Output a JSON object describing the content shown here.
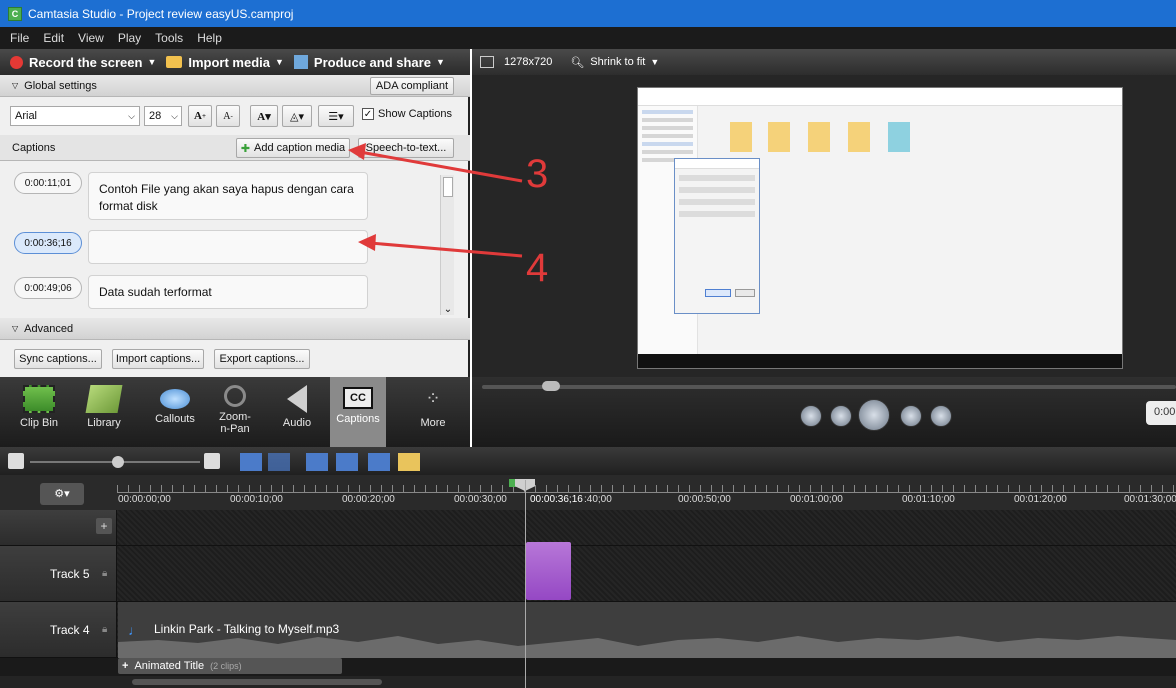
{
  "window": {
    "title": "Camtasia Studio - Project review easyUS.camproj"
  },
  "menu": [
    "File",
    "Edit",
    "View",
    "Play",
    "Tools",
    "Help"
  ],
  "toolbar": {
    "record": "Record the screen",
    "import": "Import media",
    "produce": "Produce and share"
  },
  "global": {
    "header": "Global settings",
    "ada": "ADA compliant",
    "font": "Arial",
    "size": "28",
    "show_captions": "Show Captions"
  },
  "captions": {
    "label": "Captions",
    "add_media": "Add caption media",
    "speech": "Speech-to-text...",
    "items": [
      {
        "time": "0:00:11;01",
        "text": "Contoh File yang akan saya hapus dengan cara format disk"
      },
      {
        "time": "0:00:36;16",
        "text": ""
      },
      {
        "time": "0:00:49;06",
        "text": "Data sudah terformat"
      }
    ]
  },
  "advanced": {
    "header": "Advanced",
    "sync": "Sync captions...",
    "import": "Import captions...",
    "export": "Export captions..."
  },
  "tabs": [
    "Clip Bin",
    "Library",
    "Callouts",
    "Zoom-n-Pan",
    "Audio",
    "Captions",
    "More"
  ],
  "preview": {
    "dimensions": "1278x720",
    "zoom": "Shrink to fit",
    "time": "0:00"
  },
  "annotations": {
    "n3": "3",
    "n4": "4"
  },
  "timeline": {
    "ticks": [
      "00:00:00;00",
      "00:00:10;00",
      "00:00:20;00",
      "00:00:30;00",
      ":40;00",
      "00:00:50;00",
      "00:01:00;00",
      "00:01:10;00",
      "00:01:20;00",
      "00:01:30;00"
    ],
    "playhead": "00:00:36;16",
    "tracks": [
      {
        "name": "Track 5"
      },
      {
        "name": "Track 4",
        "clip": "Linkin Park - Talking to Myself.mp3"
      }
    ],
    "animated_title": "Animated Title",
    "clips_count": "(2 clips)"
  },
  "colors": {
    "accent": "#1d6fd2",
    "arrow": "#e03a3a",
    "caption_clip": "#a45ad0"
  }
}
